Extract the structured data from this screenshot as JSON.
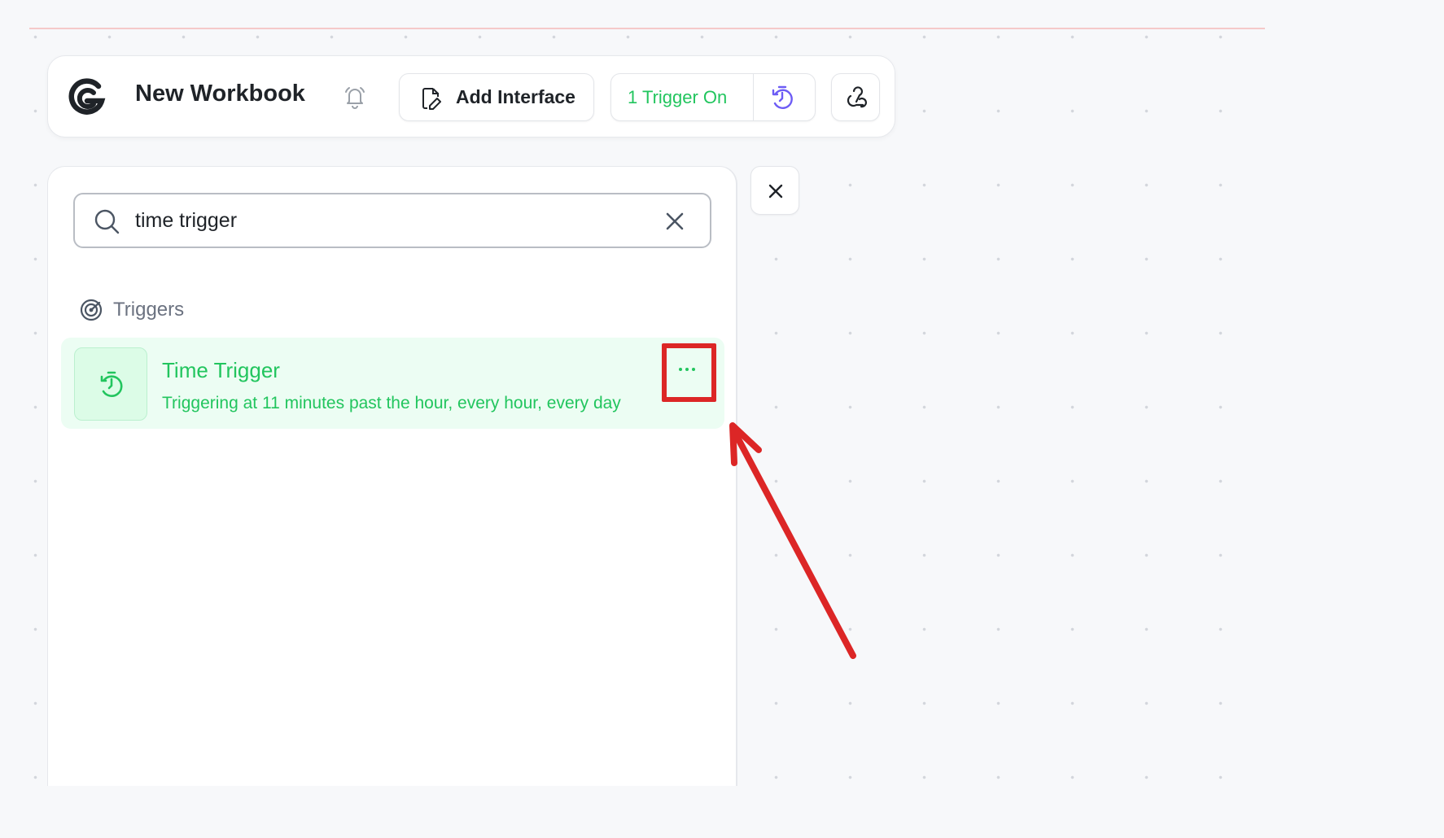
{
  "workbook": {
    "title": "New Workbook"
  },
  "toolbar": {
    "add_interface_label": "Add Interface",
    "trigger_status_label": "1 Trigger On"
  },
  "search": {
    "value": "time trigger"
  },
  "results": {
    "section_label": "Triggers",
    "items": [
      {
        "title": "Time Trigger",
        "subtitle": "Triggering at 11 minutes past the hour, every hour, every day"
      }
    ]
  },
  "icons": {
    "logo": "app-logo",
    "bell": "bell-icon",
    "add_interface": "file-edit-icon",
    "timer": "timer-icon",
    "webhook": "webhook-icon",
    "search": "search-icon",
    "clear": "close-icon",
    "triggers": "radar-icon",
    "more": "more-icon"
  },
  "colors": {
    "accent_green": "#22c55e",
    "result_bg": "#ecfdf3",
    "timer_purple": "#6d5cf5",
    "annotation_red": "#dc2626"
  }
}
